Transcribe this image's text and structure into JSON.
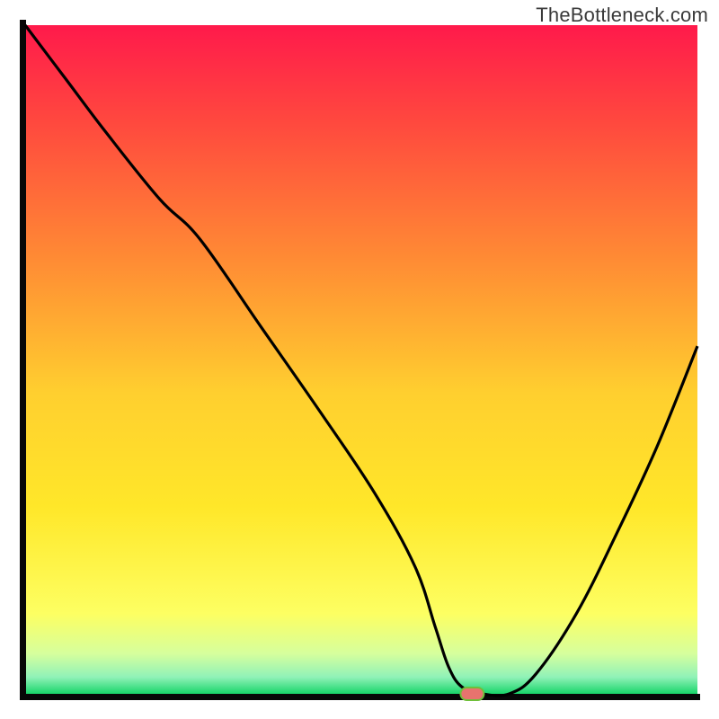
{
  "watermark": "TheBottleneck.com",
  "colors": {
    "axis": "#070707",
    "curve": "#000000",
    "marker_fill": "#e7736e",
    "marker_stroke": "#6fbf3a"
  },
  "chart_data": {
    "type": "line",
    "title": "",
    "xlabel": "",
    "ylabel": "",
    "xlim": [
      0,
      100
    ],
    "ylim": [
      0,
      100
    ],
    "grid": false,
    "legend": false,
    "background": {
      "type": "vertical-gradient",
      "stops": [
        {
          "pos": 0.0,
          "color": "#ff1a4b"
        },
        {
          "pos": 0.15,
          "color": "#ff4a3e"
        },
        {
          "pos": 0.35,
          "color": "#ff8b34"
        },
        {
          "pos": 0.55,
          "color": "#ffcf2f"
        },
        {
          "pos": 0.72,
          "color": "#ffe729"
        },
        {
          "pos": 0.88,
          "color": "#fdff62"
        },
        {
          "pos": 0.94,
          "color": "#d6ff9d"
        },
        {
          "pos": 0.975,
          "color": "#90f2b8"
        },
        {
          "pos": 1.0,
          "color": "#18d56a"
        }
      ]
    },
    "series": [
      {
        "name": "bottleneck-curve",
        "x": [
          0,
          6,
          12,
          20,
          26,
          35,
          44,
          52,
          58,
          61,
          63,
          65,
          68,
          72,
          76,
          82,
          88,
          94,
          100
        ],
        "y": [
          100,
          92,
          84,
          74,
          68,
          55,
          42,
          30,
          19,
          10,
          4,
          1,
          0,
          0,
          3,
          12,
          24,
          37,
          52
        ]
      }
    ],
    "marker": {
      "name": "optimal-point",
      "x": 66.5,
      "y": 0,
      "shape": "rounded-pill"
    }
  }
}
